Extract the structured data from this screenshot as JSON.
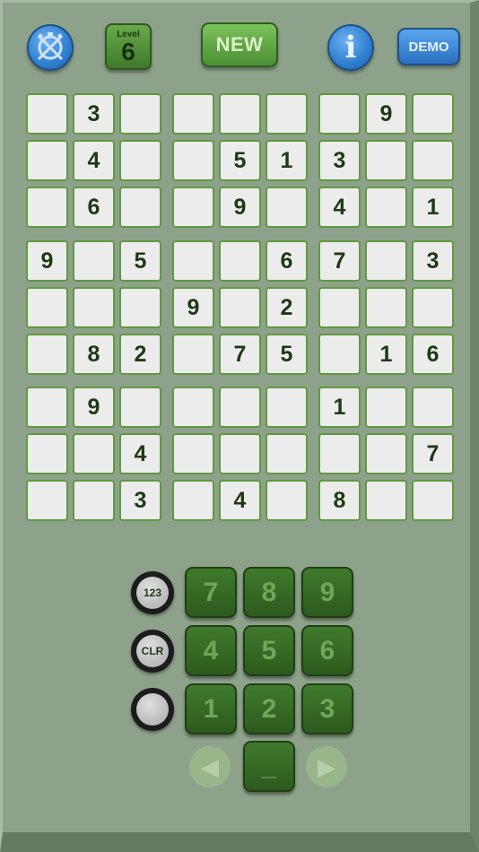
{
  "toolbar": {
    "level_label": "Level",
    "level_value": "6",
    "new_label": "NEW",
    "info_label": "i",
    "demo_label": "DEMO"
  },
  "board": [
    [
      "",
      "3",
      "",
      "",
      "",
      "",
      "",
      "9",
      ""
    ],
    [
      "",
      "4",
      "",
      "",
      "5",
      "1",
      "3",
      "",
      ""
    ],
    [
      "",
      "6",
      "",
      "",
      "9",
      "",
      "4",
      "",
      "1"
    ],
    [
      "9",
      "",
      "5",
      "",
      "",
      "6",
      "7",
      "",
      "3"
    ],
    [
      "",
      "",
      "",
      "9",
      "",
      "2",
      "",
      "",
      ""
    ],
    [
      "",
      "8",
      "2",
      "",
      "7",
      "5",
      "",
      "1",
      "6"
    ],
    [
      "",
      "9",
      "",
      "",
      "",
      "",
      "1",
      "",
      ""
    ],
    [
      "",
      "",
      "4",
      "",
      "",
      "",
      "",
      "",
      "7"
    ],
    [
      "",
      "",
      "3",
      "",
      "4",
      "",
      "8",
      "",
      ""
    ]
  ],
  "keypad": {
    "rows": [
      [
        "7",
        "8",
        "9"
      ],
      [
        "4",
        "5",
        "6"
      ],
      [
        "1",
        "2",
        "3"
      ]
    ],
    "underscore": "_",
    "toggle_label": "123",
    "clear_label": "CLR"
  },
  "colors": {
    "background": "#8ea28b",
    "cell_border": "#5f9a3e",
    "key_green": "#3f7a2c",
    "blue": "#2f7fd0"
  }
}
